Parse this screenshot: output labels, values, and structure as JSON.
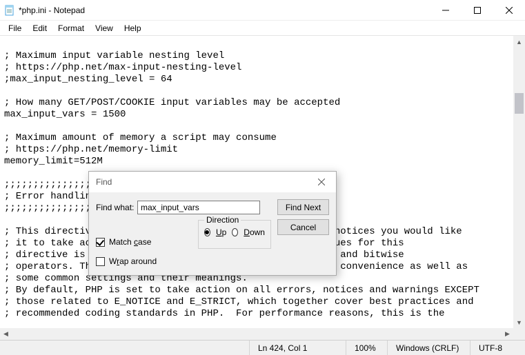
{
  "window": {
    "title": "*php.ini - Notepad"
  },
  "menu": {
    "file": "File",
    "edit": "Edit",
    "format": "Format",
    "view": "View",
    "help": "Help"
  },
  "editor": {
    "text": "\n; Maximum input variable nesting level\n; https://php.net/max-input-nesting-level\n;max_input_nesting_level = 64\n\n; How many GET/POST/COOKIE input variables may be accepted\nmax_input_vars = 1500\n\n; Maximum amount of memory a script may consume\n; https://php.net/memory-limit\nmemory_limit=512M\n\n;;;;;;;;;;;;;;;;\n; Error handlin\n;;;;;;;;;;;;;;;;\n\n; This directive                                         notices you would like\n; it to take ac                                          ues for this\n; directive is                                            and bitwise\n; operators. The error level constants are below here for convenience as well as\n; some common settings and their meanings.\n; By default, PHP is set to take action on all errors, notices and warnings EXCEPT\n; those related to E_NOTICE and E_STRICT, which together cover best practices and\n; recommended coding standards in PHP.  For performance reasons, this is the"
  },
  "find": {
    "title": "Find",
    "find_what_label": "Find what:",
    "find_what_value": "max_input_vars",
    "find_next": "Find Next",
    "cancel": "Cancel",
    "direction_label": "Direction",
    "up": "Up",
    "down": "Down",
    "direction_selected": "up",
    "match_case_label": "Match case",
    "match_case_checked": true,
    "wrap_around_label": "Wrap around",
    "wrap_around_checked": false
  },
  "status": {
    "position": "Ln 424, Col 1",
    "zoom": "100%",
    "line_ending": "Windows (CRLF)",
    "encoding": "UTF-8"
  }
}
